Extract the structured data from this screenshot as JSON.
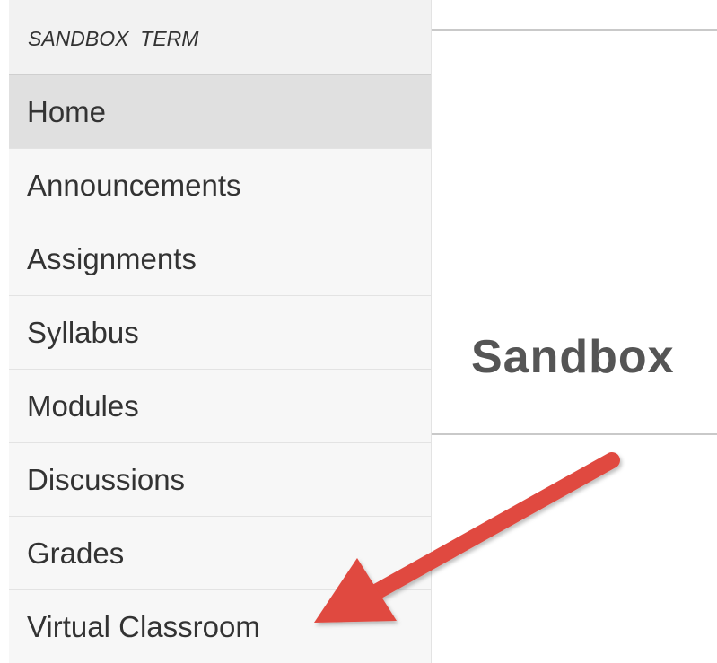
{
  "sidebar": {
    "term": "SANDBOX_TERM",
    "items": [
      {
        "label": "Home"
      },
      {
        "label": "Announcements"
      },
      {
        "label": "Assignments"
      },
      {
        "label": "Syllabus"
      },
      {
        "label": "Modules"
      },
      {
        "label": "Discussions"
      },
      {
        "label": "Grades"
      },
      {
        "label": "Virtual Classroom"
      }
    ],
    "active_item": "Home"
  },
  "main": {
    "course_title": "Sandbox"
  },
  "annotation": {
    "arrow_icon": "red-arrow-icon",
    "arrow_color": "#e04a3f"
  },
  "colors": {
    "sidebar_bg": "#f7f7f7",
    "active_bg": "#e0e0e0",
    "text": "#333333"
  }
}
